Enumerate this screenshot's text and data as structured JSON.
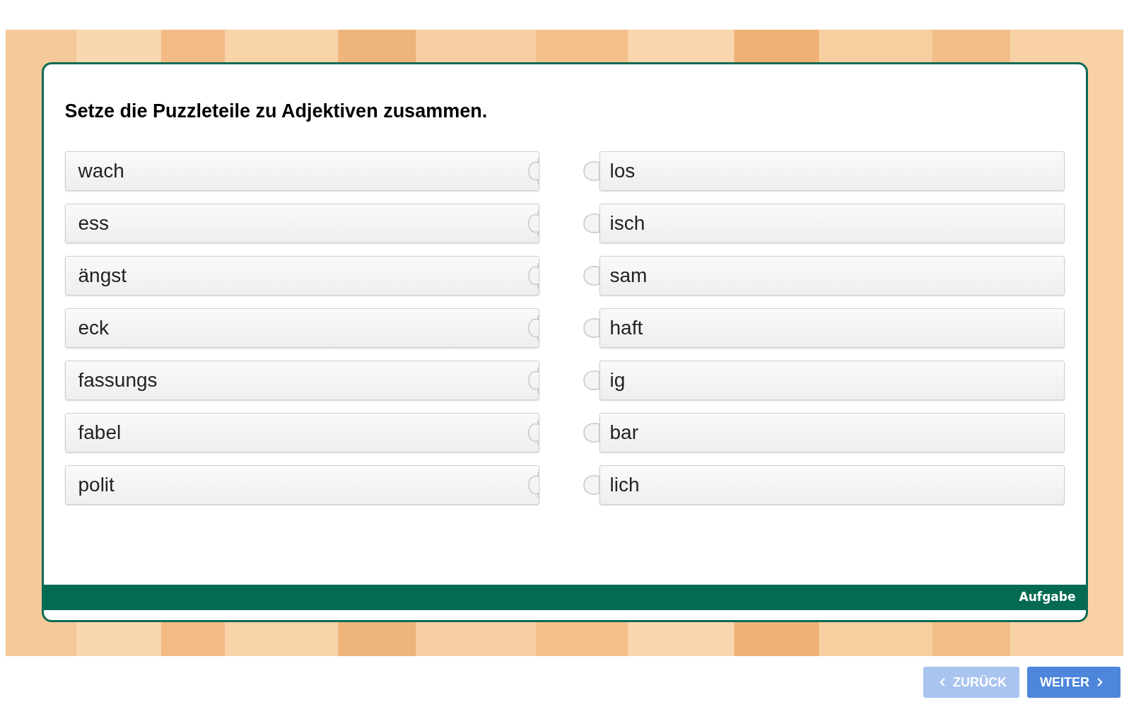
{
  "title": "Setze die Puzzleteile zu Adjektiven zusammen.",
  "left_pieces": [
    {
      "label": "wach"
    },
    {
      "label": "ess"
    },
    {
      "label": "ängst"
    },
    {
      "label": "eck"
    },
    {
      "label": "fassungs"
    },
    {
      "label": "fabel"
    },
    {
      "label": "polit"
    }
  ],
  "right_pieces": [
    {
      "label": "los"
    },
    {
      "label": "isch"
    },
    {
      "label": "sam"
    },
    {
      "label": "haft"
    },
    {
      "label": "ig"
    },
    {
      "label": "bar"
    },
    {
      "label": "lich"
    }
  ],
  "footer_label": "Aufgabe",
  "buttons": [
    {
      "kind": "back",
      "label": "ZURÜCK",
      "disabled": true
    },
    {
      "kind": "next",
      "label": "WEITER",
      "disabled": false
    }
  ]
}
